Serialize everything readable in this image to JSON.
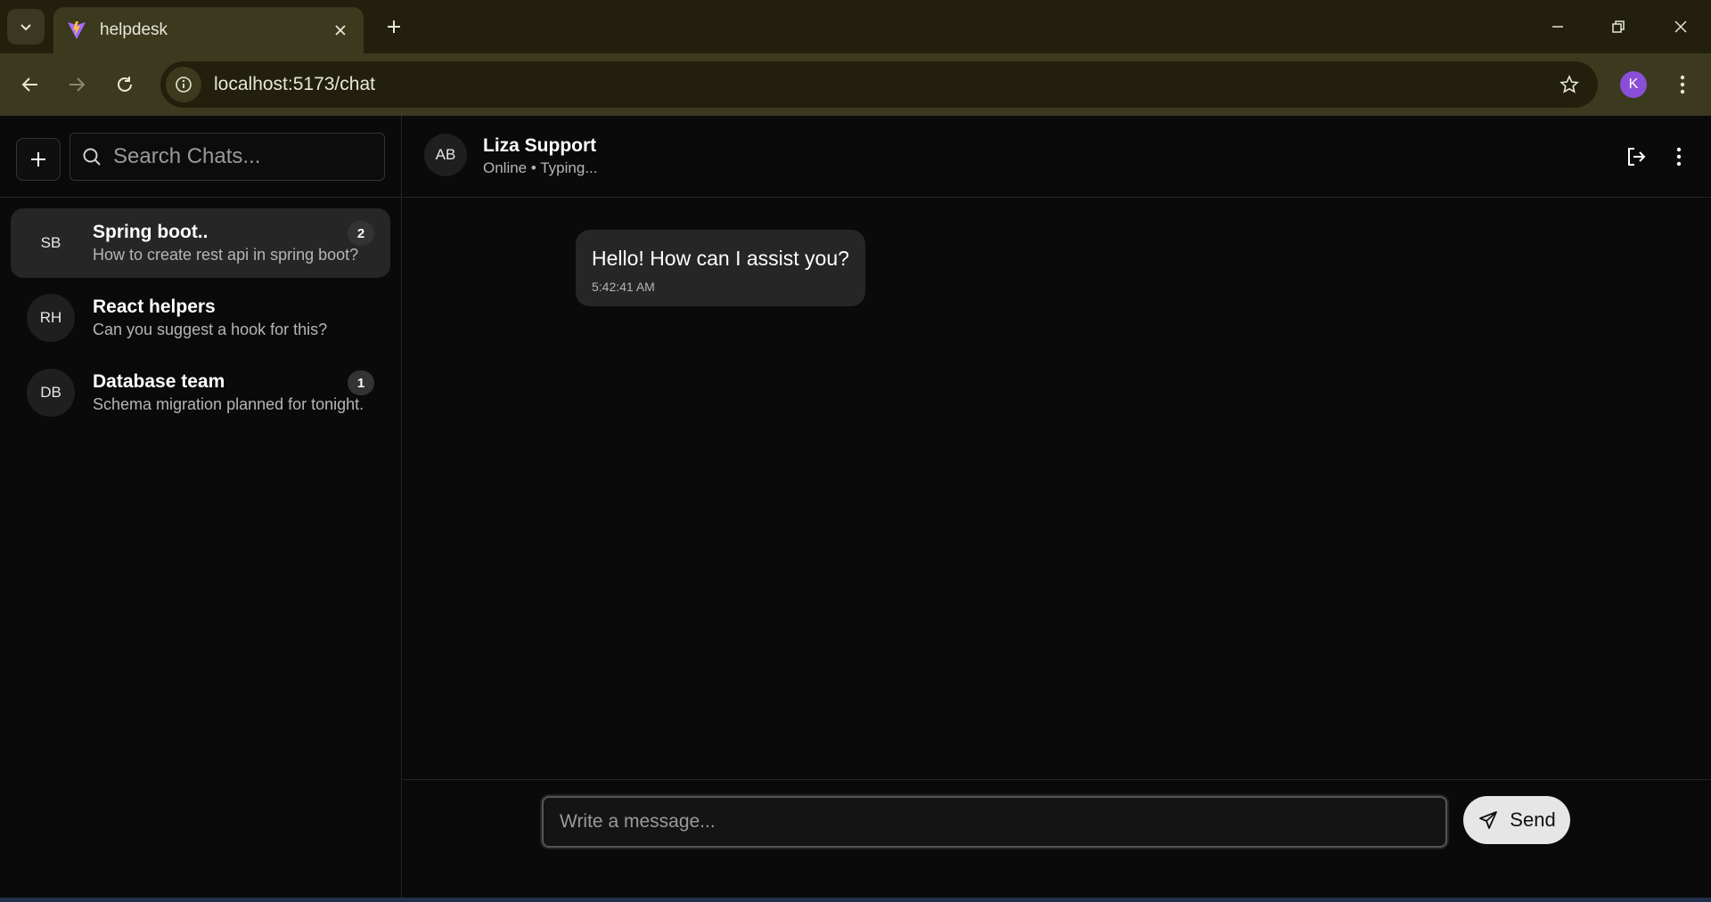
{
  "browser": {
    "tab_title": "helpdesk",
    "url": "localhost:5173/chat",
    "profile_initial": "K"
  },
  "sidebar": {
    "search_placeholder": "Search Chats...",
    "chats": [
      {
        "initials": "SB",
        "name": "Spring boot..",
        "preview": "How to create rest api in spring boot?",
        "badge": "2",
        "active": true
      },
      {
        "initials": "RH",
        "name": "React helpers",
        "preview": "Can you suggest a hook for this?",
        "badge": "",
        "active": false
      },
      {
        "initials": "DB",
        "name": "Database team",
        "preview": "Schema migration planned for tonight.",
        "badge": "1",
        "active": false
      }
    ]
  },
  "conversation": {
    "avatar_initials": "AB",
    "name": "Liza Support",
    "status": "Online • Typing...",
    "messages": [
      {
        "text": "Hello! How can I assist you?",
        "time": "5:42:41 AM"
      }
    ]
  },
  "composer": {
    "placeholder": "Write a message...",
    "send_label": "Send"
  },
  "colors": {
    "chrome_bg": "#22200d",
    "toolbar_bg": "#3b3a1f",
    "app_bg": "#0a0a0a",
    "active_chat_bg": "#262626",
    "profile": "#8a4fd6"
  }
}
